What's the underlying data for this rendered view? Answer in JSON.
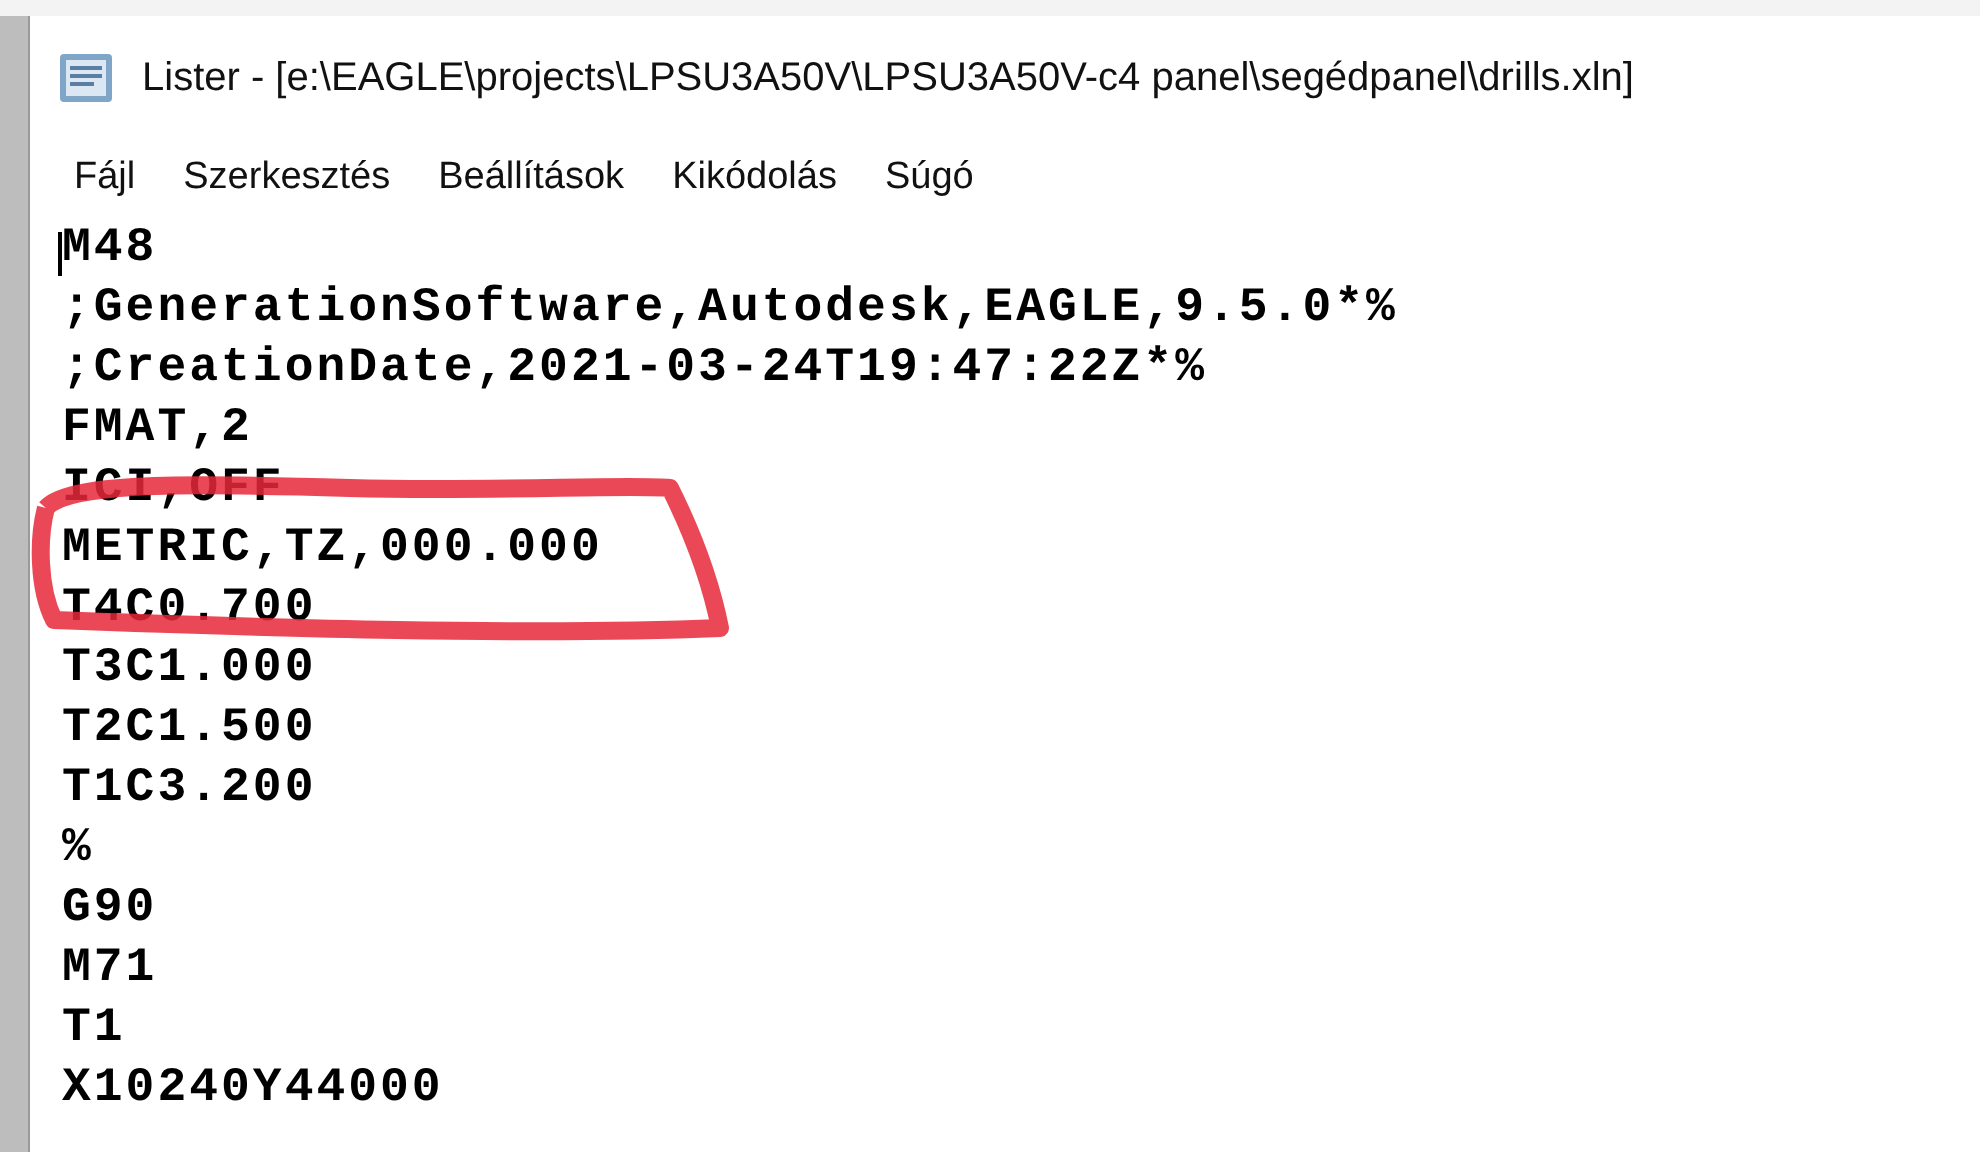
{
  "window": {
    "title": "Lister - [e:\\EAGLE\\projects\\LPSU3A50V\\LPSU3A50V-c4 panel\\segédpanel\\drills.xln]"
  },
  "menu": [
    "Fájl",
    "Szerkesztés",
    "Beállítások",
    "Kikódolás",
    "Súgó"
  ],
  "lines": [
    "M48",
    ";GenerationSoftware,Autodesk,EAGLE,9.5.0*%",
    ";CreationDate,2021-03-24T19:47:22Z*%",
    "FMAT,2",
    "ICI,OFF",
    "METRIC,TZ,000.000",
    "T4C0.700",
    "T3C1.000",
    "T2C1.500",
    "T1C3.200",
    "%",
    "G90",
    "M71",
    "T1",
    "X10240Y44000"
  ]
}
